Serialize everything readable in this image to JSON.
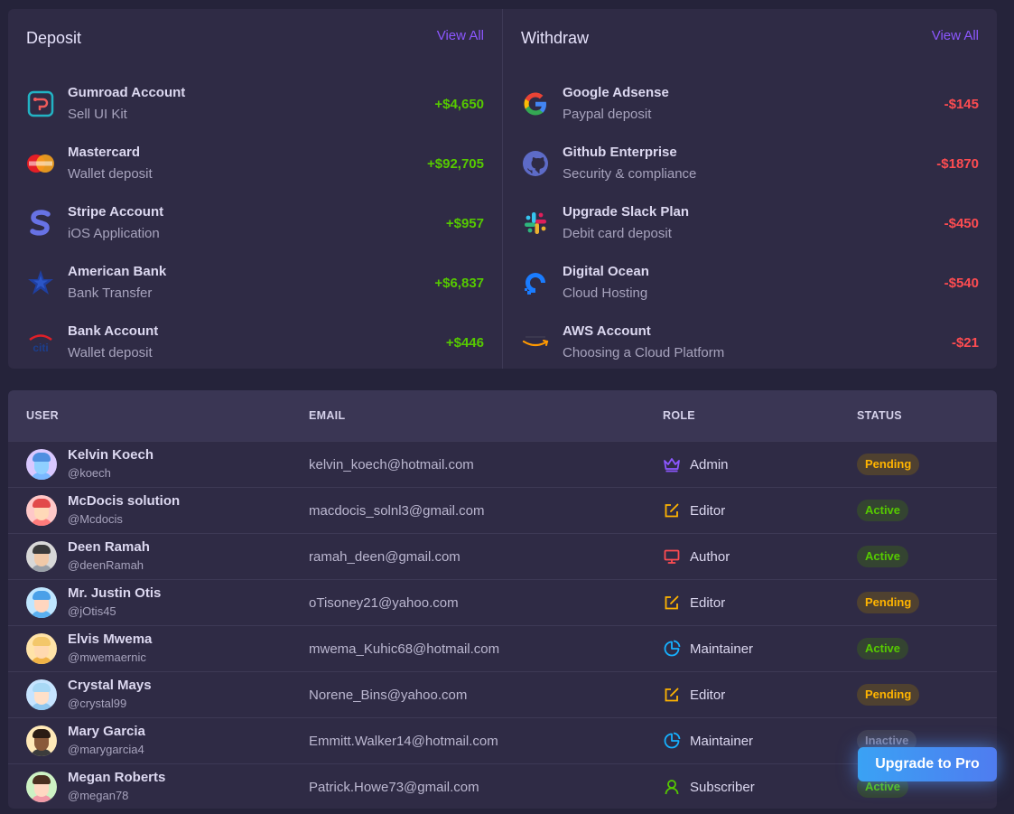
{
  "deposit": {
    "title": "Deposit",
    "view_all": "View All",
    "items": [
      {
        "name": "Gumroad Account",
        "sub": "Sell UI Kit",
        "amount": "+$4,650",
        "icon": "gumroad-icon"
      },
      {
        "name": "Mastercard",
        "sub": "Wallet deposit",
        "amount": "+$92,705",
        "icon": "mastercard-icon"
      },
      {
        "name": "Stripe Account",
        "sub": "iOS Application",
        "amount": "+$957",
        "icon": "stripe-icon"
      },
      {
        "name": "American Bank",
        "sub": "Bank Transfer",
        "amount": "+$6,837",
        "icon": "american-bank-icon"
      },
      {
        "name": "Bank Account",
        "sub": "Wallet deposit",
        "amount": "+$446",
        "icon": "citi-bank-icon"
      }
    ]
  },
  "withdraw": {
    "title": "Withdraw",
    "view_all": "View All",
    "items": [
      {
        "name": "Google Adsense",
        "sub": "Paypal deposit",
        "amount": "-$145",
        "icon": "google-icon"
      },
      {
        "name": "Github Enterprise",
        "sub": "Security & compliance",
        "amount": "-$1870",
        "icon": "github-icon"
      },
      {
        "name": "Upgrade Slack Plan",
        "sub": "Debit card deposit",
        "amount": "-$450",
        "icon": "slack-icon"
      },
      {
        "name": "Digital Ocean",
        "sub": "Cloud Hosting",
        "amount": "-$540",
        "icon": "digital-ocean-icon"
      },
      {
        "name": "AWS Account",
        "sub": "Choosing a Cloud Platform",
        "amount": "-$21",
        "icon": "aws-icon"
      }
    ]
  },
  "table": {
    "headers": {
      "user": "USER",
      "email": "EMAIL",
      "role": "ROLE",
      "status": "STATUS"
    },
    "rows": [
      {
        "name": "Kelvin Koech",
        "handle": "@koech",
        "email": "kelvin_koech@hotmail.com",
        "role": "Admin",
        "role_icon": "crown-icon",
        "status": "Pending"
      },
      {
        "name": "McDocis solution",
        "handle": "@Mcdocis",
        "email": "macdocis_solnl3@gmail.com",
        "role": "Editor",
        "role_icon": "edit-icon",
        "status": "Active"
      },
      {
        "name": "Deen Ramah",
        "handle": "@deenRamah",
        "email": "ramah_deen@gmail.com",
        "role": "Author",
        "role_icon": "monitor-icon",
        "status": "Active"
      },
      {
        "name": "Mr. Justin Otis",
        "handle": "@jOtis45",
        "email": "oTisoney21@yahoo.com",
        "role": "Editor",
        "role_icon": "edit-icon",
        "status": "Pending"
      },
      {
        "name": "Elvis Mwema",
        "handle": "@mwemaernic",
        "email": "mwema_Kuhic68@hotmail.com",
        "role": "Maintainer",
        "role_icon": "pie-chart-icon",
        "status": "Active"
      },
      {
        "name": "Crystal Mays",
        "handle": "@crystal99",
        "email": "Norene_Bins@yahoo.com",
        "role": "Editor",
        "role_icon": "edit-icon",
        "status": "Pending"
      },
      {
        "name": "Mary Garcia",
        "handle": "@marygarcia4",
        "email": "Emmitt.Walker14@hotmail.com",
        "role": "Maintainer",
        "role_icon": "pie-chart-icon",
        "status": "Inactive"
      },
      {
        "name": "Megan Roberts",
        "handle": "@megan78",
        "email": "Patrick.Howe73@gmail.com",
        "role": "Subscriber",
        "role_icon": "user-icon",
        "status": "Active"
      }
    ]
  },
  "upgrade_button": "Upgrade to Pro",
  "colors": {
    "accent": "#8c57ff",
    "positive": "#56ca00",
    "negative": "#ff4c51",
    "warning": "#ffb400"
  }
}
